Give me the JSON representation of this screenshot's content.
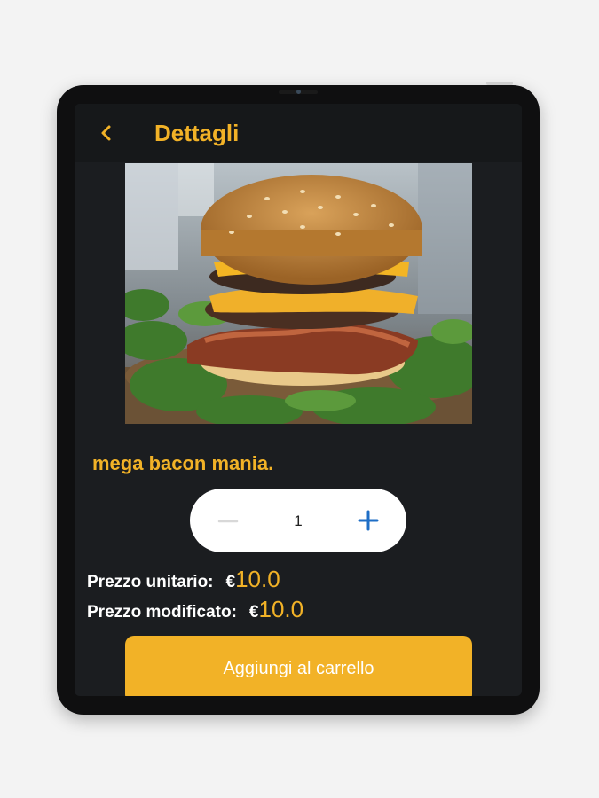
{
  "header": {
    "back_icon": "chevron-left-icon",
    "title": "Dettagli"
  },
  "product": {
    "image_alt": "burger",
    "name": "mega bacon mania."
  },
  "quantity": {
    "minus_icon": "minus-icon",
    "value": "1",
    "plus_icon": "plus-icon"
  },
  "prices": {
    "unit_label": "Prezzo unitario:",
    "unit_currency": "€",
    "unit_value": "10.0",
    "modified_label": "Prezzo modificato:",
    "modified_currency": "€",
    "modified_value": "10.0"
  },
  "actions": {
    "add_to_cart": "Aggiungi al carrello"
  },
  "colors": {
    "accent": "#f2b227",
    "screen_bg": "#1b1d20",
    "plus": "#1e6ec6"
  }
}
